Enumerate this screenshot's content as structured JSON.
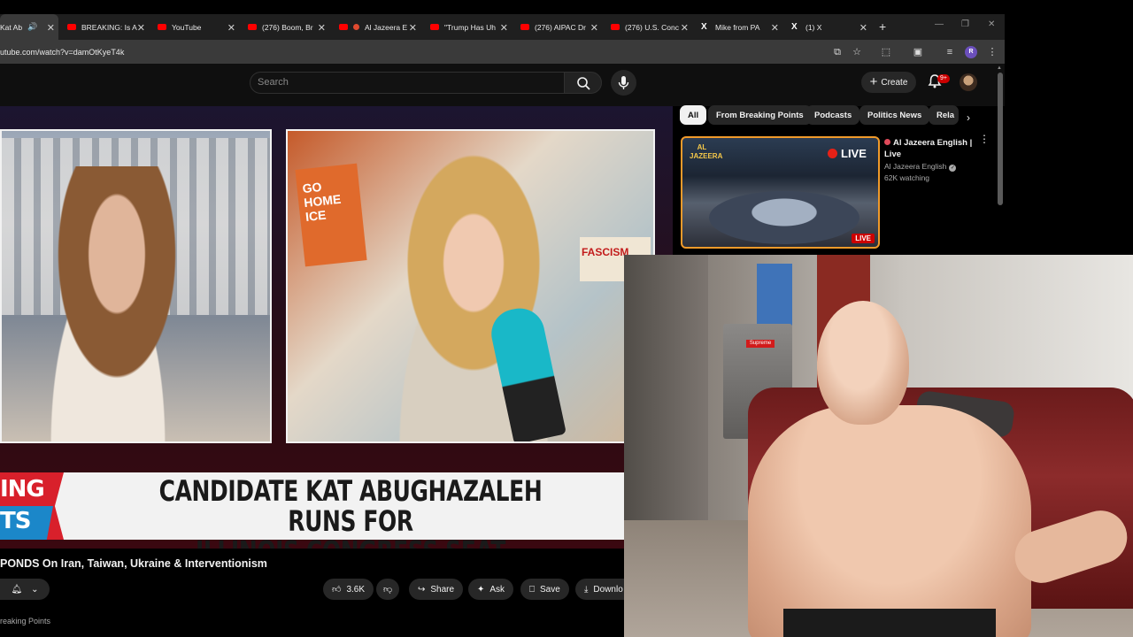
{
  "browser": {
    "tabs": [
      {
        "label": "Kat Ab",
        "active": true,
        "favicon": "youtube-icon"
      },
      {
        "label": "BREAKING: Is A",
        "favicon": "youtube-icon"
      },
      {
        "label": "YouTube",
        "favicon": "youtube-icon"
      },
      {
        "label": "(276) Boom, Br",
        "favicon": "youtube-icon"
      },
      {
        "label": "Al Jazeera E",
        "favicon": "youtube-icon"
      },
      {
        "label": "\"Trump Has Uh",
        "favicon": "youtube-icon"
      },
      {
        "label": "(276) AIPAC Dr",
        "favicon": "youtube-icon"
      },
      {
        "label": "(276) U.S. Conc",
        "favicon": "youtube-icon"
      },
      {
        "label": "Mike from PA",
        "favicon": "x-icon"
      },
      {
        "label": "(1) X",
        "favicon": "x-icon"
      }
    ],
    "url": "utube.com/watch?v=damOtKyeT4k",
    "profile_initial": "R"
  },
  "youtube": {
    "search_placeholder": "Search",
    "create_label": "Create",
    "notifications_count": "9+"
  },
  "video": {
    "lower_third_left_top": "ING",
    "lower_third_left_bottom": "TS",
    "headline_line1": "CANDIDATE KAT ABUGHAZALEH RUNS FOR",
    "headline_line2": "ILLINOIS CONGRESS SEAT",
    "sign_home": "GO HOME ICE",
    "sign_fascism": "FASCISM",
    "title": "PONDS On Iran, Taiwan, Ukraine & Interventionism",
    "channel": "reaking Points"
  },
  "actions": {
    "like_count": "3.6K",
    "share": "Share",
    "ask": "Ask",
    "save": "Save",
    "download": "Downlo"
  },
  "chips": [
    "All",
    "From Breaking Points",
    "Podcasts",
    "Politics News",
    "Rela"
  ],
  "recommendation": {
    "title": "Al Jazeera English | Live",
    "channel": "Al Jazeera English",
    "views": "62K watching",
    "live_big": "LIVE",
    "live_badge": "LIVE",
    "logo_text": "AL JAZEERA"
  },
  "webcam": {
    "fridge_sticker": "Supreme"
  }
}
